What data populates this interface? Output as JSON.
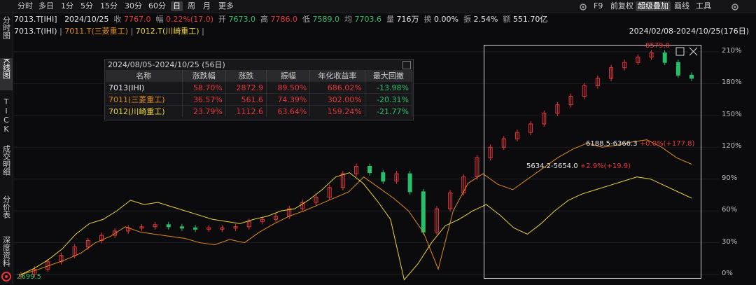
{
  "topbar": {
    "periods": [
      "分时",
      "多日",
      "1分",
      "5分",
      "15分",
      "30分",
      "60分",
      "日",
      "周",
      "月",
      "更多"
    ],
    "active_period": "日",
    "right_items": [
      "F9",
      "前复权",
      "超级叠加",
      "画线",
      "工具"
    ],
    "highlighted": "超级叠加"
  },
  "quote": {
    "code": "7013.T[IHI]",
    "date": "2024/10/25",
    "close_label": "收",
    "close": "7767.0",
    "change_label": "幅",
    "change": "0.22%(17.0)",
    "open_label": "开",
    "open": "7673.0",
    "high_label": "高",
    "high": "7786.0",
    "low_label": "低",
    "low": "7589.0",
    "avg_label": "均",
    "avg": "7703.6",
    "volume_label": "量",
    "volume": "716万",
    "turnover_label": "换",
    "turnover": "0.00%",
    "amplitude_label": "振",
    "amplitude": "2.54%",
    "amount_label": "额",
    "amount": "551.70亿"
  },
  "overlay_legend": {
    "main": "7013.T(IHI)",
    "s1": "7011.T(三菱重工)",
    "s2": "7012.T(川崎重工)",
    "range": "2024/02/08-2024/10/25(176日)"
  },
  "left_tabs": [
    "分时图",
    "K线图",
    "TICK",
    "成交明细",
    "分价表",
    "深度资料"
  ],
  "stats": {
    "title": "2024/08/05-2024/10/25 (56日)",
    "headers": [
      "名称",
      "涨跌幅",
      "涨跌",
      "振幅",
      "年化收益率",
      "最大回撤"
    ],
    "rows": [
      {
        "name": "7013(IHI)",
        "chg_pct": "58.70%",
        "chg": "2872.9",
        "amp": "89.50%",
        "annual": "686.02%",
        "drawdown": "-13.98%"
      },
      {
        "name": "7011(三菱重工)",
        "chg_pct": "36.57%",
        "chg": "561.6",
        "amp": "74.39%",
        "annual": "302.00%",
        "drawdown": "-20.31%"
      },
      {
        "name": "7012(川崎重工)",
        "chg_pct": "23.79%",
        "chg": "1112.6",
        "amp": "63.64%",
        "annual": "159.24%",
        "drawdown": "-21.77%"
      }
    ]
  },
  "y_axis": [
    "210%",
    "180%",
    "150%",
    "120%",
    "90%",
    "60%",
    "30%",
    "0%"
  ],
  "annotations": {
    "high": "8579.0",
    "low": "2699.5",
    "range1": "6188.5-6366.3",
    "range1_chg": "+0.0%(+177.8)",
    "range2": "5634.2-5654.0",
    "range2_chg": "+2.9%(+19.9)"
  },
  "colors": {
    "up": "#e8353a",
    "down": "#27c06a",
    "s1": "#e08a1e",
    "s2": "#ecd43a",
    "bg": "#0b0b0d"
  },
  "chart_data": {
    "type": "line",
    "y_unit": "%",
    "ylim": [
      0,
      220
    ],
    "series": [
      {
        "name": "7013.T(IHI)",
        "values": [
          0,
          5,
          12,
          18,
          26,
          32,
          37,
          41,
          44,
          45,
          47,
          45,
          44,
          43,
          44,
          44,
          45,
          50,
          52,
          55,
          62,
          68,
          73,
          82,
          95,
          102,
          96,
          88,
          95,
          78,
          40,
          62,
          77,
          92,
          110,
          120,
          128,
          134,
          142,
          152,
          160,
          168,
          178,
          185,
          195,
          200,
          205,
          209,
          200,
          188,
          185
        ]
      },
      {
        "name": "7011.T(三菱重工)",
        "values": [
          0,
          4,
          9,
          14,
          20,
          30,
          36,
          45,
          40,
          38,
          36,
          34,
          30,
          28,
          33,
          30,
          40,
          48,
          55,
          60,
          66,
          72,
          78,
          92,
          82,
          72,
          60,
          40,
          5,
          60,
          86,
          95,
          85,
          80,
          90,
          100,
          110,
          118,
          124,
          120,
          122,
          125,
          127,
          120,
          110,
          104
        ]
      },
      {
        "name": "7012.T(川崎重工)",
        "values": [
          0,
          6,
          14,
          24,
          38,
          48,
          52,
          60,
          70,
          66,
          68,
          64,
          60,
          56,
          52,
          50,
          48,
          52,
          55,
          60,
          62,
          70,
          80,
          92,
          96,
          86,
          70,
          52,
          -5,
          10,
          30,
          46,
          52,
          60,
          66,
          56,
          44,
          38,
          48,
          60,
          70,
          76,
          80,
          84,
          88,
          92,
          90,
          84,
          78,
          72
        ]
      }
    ]
  }
}
